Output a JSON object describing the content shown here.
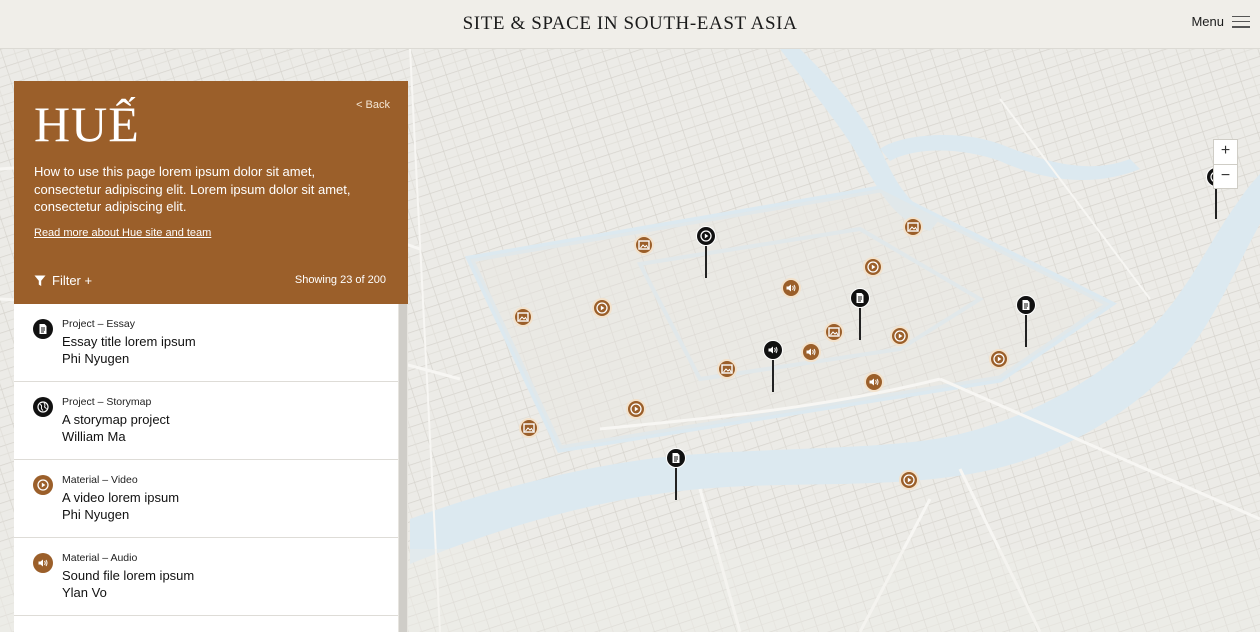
{
  "header": {
    "title": "SITE & SPACE IN SOUTH-EAST ASIA",
    "menu_label": "Menu"
  },
  "panel": {
    "city": "HUẾ",
    "back_label": "<  Back",
    "intro": "How to use this page lorem ipsum dolor sit amet, consectetur adipiscing elit. Lorem ipsum dolor sit amet, consectetur adipiscing elit.",
    "read_more": "Read more about Hue site and team",
    "filter_label": "Filter +",
    "showing": "Showing 23 of 200"
  },
  "zoom": {
    "in": "+",
    "out": "−"
  },
  "list": [
    {
      "category": "Project – Essay",
      "title": "Essay title lorem ipsum",
      "author": "Phi Nyugen",
      "icon": "document-icon"
    },
    {
      "category": "Project – Storymap",
      "title": "A storymap project",
      "author": "William Ma",
      "icon": "globe-icon"
    },
    {
      "category": "Material – Video",
      "title": "A video lorem ipsum",
      "author": "Phi Nyugen",
      "icon": "play-icon"
    },
    {
      "category": "Material – Audio",
      "title": "Sound file lorem ipsum",
      "author": "Ylan Vo",
      "icon": "speaker-icon"
    }
  ],
  "colors": {
    "accent": "#9b5f2a",
    "map_bg": "#ecebe7",
    "water": "#dce9f0",
    "pin": "#111111"
  }
}
